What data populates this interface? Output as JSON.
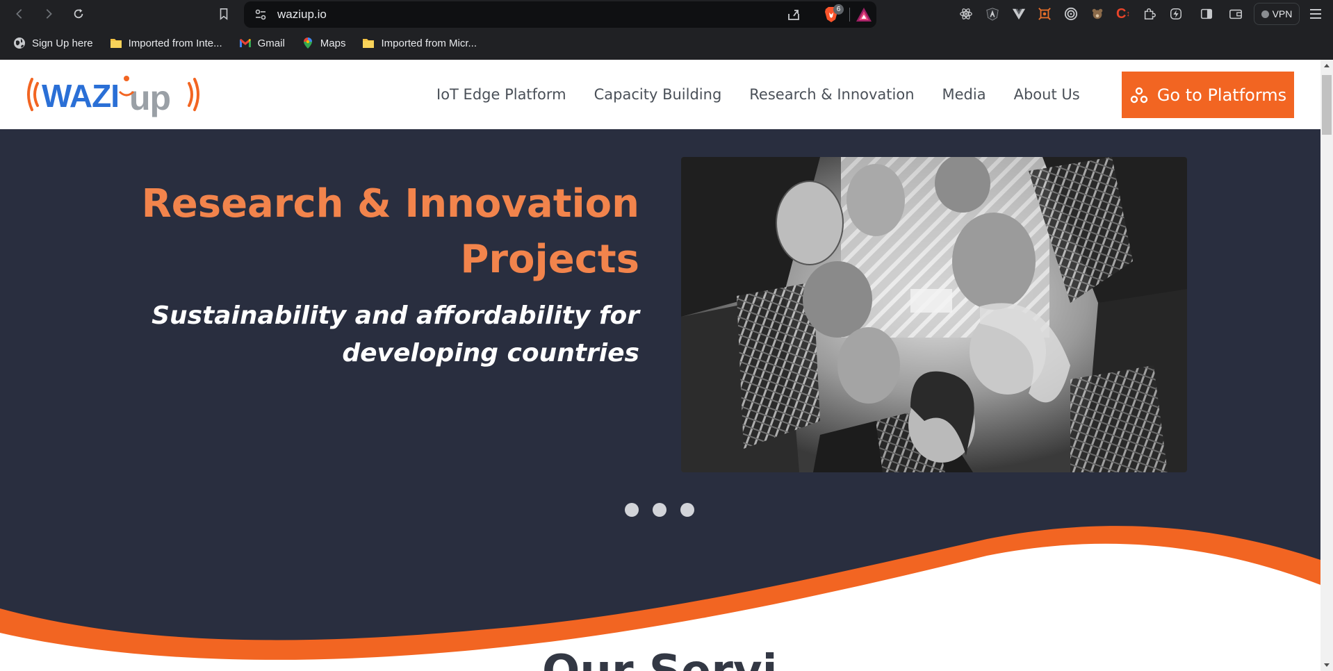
{
  "browser": {
    "url": "waziup.io",
    "brave_shields_count": "6",
    "vpn_label": "VPN",
    "bookmarks": [
      {
        "label": "Sign Up here",
        "icon": "globe-icon"
      },
      {
        "label": "Imported from Inte...",
        "icon": "folder-icon"
      },
      {
        "label": "Gmail",
        "icon": "gmail-icon"
      },
      {
        "label": "Maps",
        "icon": "maps-icon"
      },
      {
        "label": "Imported from Micr...",
        "icon": "folder-icon"
      }
    ]
  },
  "site": {
    "logo_text": "WAZIUP",
    "nav": [
      "IoT Edge Platform",
      "Capacity Building",
      "Research & Innovation",
      "Media",
      "About Us"
    ],
    "cta_label": "Go to Platforms",
    "colors": {
      "accent": "#f26522",
      "hero_bg": "#292e3f",
      "title": "#f2844c",
      "logo_blue": "#2a6fd6"
    }
  },
  "hero": {
    "title_line1": "Research & Innovation",
    "title_line2": "Projects",
    "subtitle_line1": "Sustainability and affordability for",
    "subtitle_line2": "developing countries",
    "carousel_slides": 3
  },
  "next_section_heading_partial": "Our Servi"
}
